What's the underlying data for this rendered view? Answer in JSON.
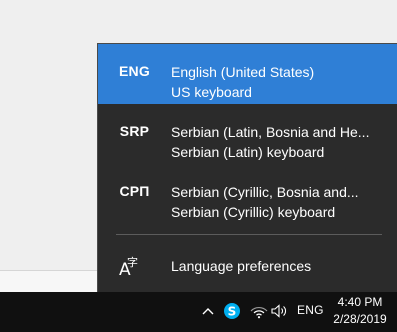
{
  "flyout": {
    "languages": [
      {
        "code": "ENG",
        "name": "English (United States)",
        "keyboard": "US keyboard",
        "selected": true
      },
      {
        "code": "SRP",
        "name": "Serbian (Latin, Bosnia and He...",
        "keyboard": "Serbian (Latin) keyboard",
        "selected": false
      },
      {
        "code": "СРП",
        "name": "Serbian (Cyrillic, Bosnia and...",
        "keyboard": "Serbian (Cyrillic) keyboard",
        "selected": false
      }
    ],
    "preferences_label": "Language preferences",
    "preferences_icon": "language-preferences-icon"
  },
  "taskbar": {
    "tray_icons": [
      "chevron-up-icon",
      "skype-icon",
      "wifi-icon",
      "volume-icon"
    ],
    "input_indicator": "ENG",
    "clock_time": "4:40 PM",
    "clock_date": "2/28/2019"
  },
  "colors": {
    "flyout_bg": "#2b2b2b",
    "selected_bg": "#2f7fd6",
    "taskbar_bg": "#101010",
    "skype_blue": "#00aff0",
    "desktop_bg": "#efefef"
  }
}
